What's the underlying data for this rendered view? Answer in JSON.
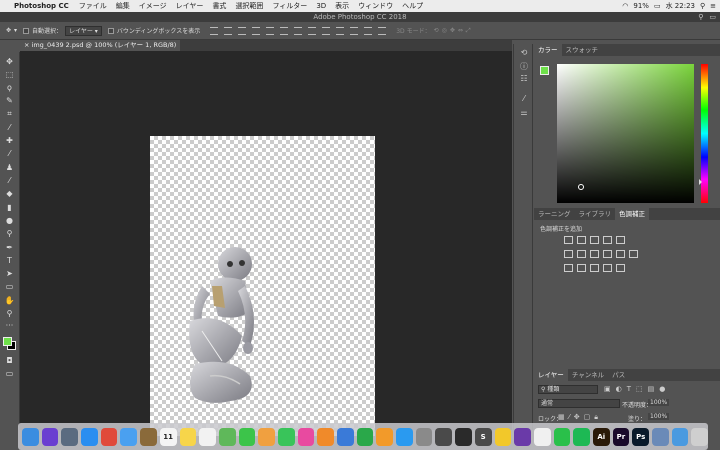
{
  "menubar": {
    "app": "Photoshop CC",
    "items": [
      "ファイル",
      "編集",
      "イメージ",
      "レイヤー",
      "書式",
      "選択範囲",
      "フィルター",
      "3D",
      "表示",
      "ウィンドウ",
      "ヘルプ"
    ],
    "battery": "91%",
    "clock": "水 22:23"
  },
  "window_title": "Adobe Photoshop CC 2018",
  "options_bar": {
    "auto_select_label": "自動選択：",
    "auto_select_value": "レイヤー",
    "bounding_box_label": "バウンディングボックスを表示",
    "mode_3d_label": "3D モード："
  },
  "document_tab": "img_0439 2.psd @ 100% (レイヤー 1, RGB/8)",
  "color_panel": {
    "tabs": [
      "カラー",
      "スウォッチ"
    ],
    "foreground": "#6ee04a",
    "background": "#000000"
  },
  "adjust_panel": {
    "tabs": [
      "ラーニング",
      "ライブラリ",
      "色調補正"
    ],
    "add_label": "色調補正を追加"
  },
  "layers_panel": {
    "tabs": [
      "レイヤー",
      "チャンネル",
      "パス"
    ],
    "filter_label": "種類",
    "blend_mode": "通常",
    "opacity_label": "不透明度：",
    "opacity_value": "100%",
    "lock_label": "ロック：",
    "fill_label": "塗り：",
    "fill_value": "100%"
  },
  "dock_apps": [
    {
      "name": "finder",
      "label": "",
      "color": "#3b8de0"
    },
    {
      "name": "siri",
      "label": "",
      "color": "#6a3fd1"
    },
    {
      "name": "launchpad",
      "label": "",
      "color": "#5a6b80"
    },
    {
      "name": "safari",
      "label": "",
      "color": "#2a8ef0"
    },
    {
      "name": "chrome",
      "label": "",
      "color": "#e04a3a"
    },
    {
      "name": "mail",
      "label": "",
      "color": "#4aa0f0"
    },
    {
      "name": "notes-brown",
      "label": "",
      "color": "#8a6a3a"
    },
    {
      "name": "calendar",
      "label": "11",
      "color": "#f4f4f4"
    },
    {
      "name": "notes",
      "label": "",
      "color": "#f7d54a"
    },
    {
      "name": "reminders",
      "label": "",
      "color": "#f2f2f2"
    },
    {
      "name": "maps",
      "label": "",
      "color": "#5fb85a"
    },
    {
      "name": "facetime",
      "label": "",
      "color": "#3cc44a"
    },
    {
      "name": "photos",
      "label": "",
      "color": "#f0a040"
    },
    {
      "name": "messages",
      "label": "",
      "color": "#39c45a"
    },
    {
      "name": "itunes",
      "label": "",
      "color": "#e84aa0"
    },
    {
      "name": "ibooks",
      "label": "",
      "color": "#f08a2a"
    },
    {
      "name": "keynote",
      "label": "",
      "color": "#3a7ad8"
    },
    {
      "name": "numbers",
      "label": "",
      "color": "#2aa84a"
    },
    {
      "name": "pages",
      "label": "",
      "color": "#f29a2a"
    },
    {
      "name": "appstore",
      "label": "",
      "color": "#2a9af0"
    },
    {
      "name": "sysprefs",
      "label": "",
      "color": "#8a8a8a"
    },
    {
      "name": "atom",
      "label": "",
      "color": "#4a4a4a"
    },
    {
      "name": "terminal",
      "label": "",
      "color": "#2a2a2a"
    },
    {
      "name": "sublime",
      "label": "S",
      "color": "#4a4a4a"
    },
    {
      "name": "norton",
      "label": "",
      "color": "#f2c82a"
    },
    {
      "name": "github",
      "label": "",
      "color": "#6a3aa8"
    },
    {
      "name": "app-pin",
      "label": "",
      "color": "#f0f0f0"
    },
    {
      "name": "line",
      "label": "",
      "color": "#2ac04a"
    },
    {
      "name": "spotify",
      "label": "",
      "color": "#1db954"
    },
    {
      "name": "illustrator",
      "label": "Ai",
      "color": "#2a1a08"
    },
    {
      "name": "premiere",
      "label": "Pr",
      "color": "#1a0a2a"
    },
    {
      "name": "photoshop",
      "label": "Ps",
      "color": "#0a1a2a"
    },
    {
      "name": "preview",
      "label": "",
      "color": "#6a8ab8"
    },
    {
      "name": "folder",
      "label": "",
      "color": "#4a9ae0"
    },
    {
      "name": "trash",
      "label": "",
      "color": "#cfcfcf"
    }
  ]
}
